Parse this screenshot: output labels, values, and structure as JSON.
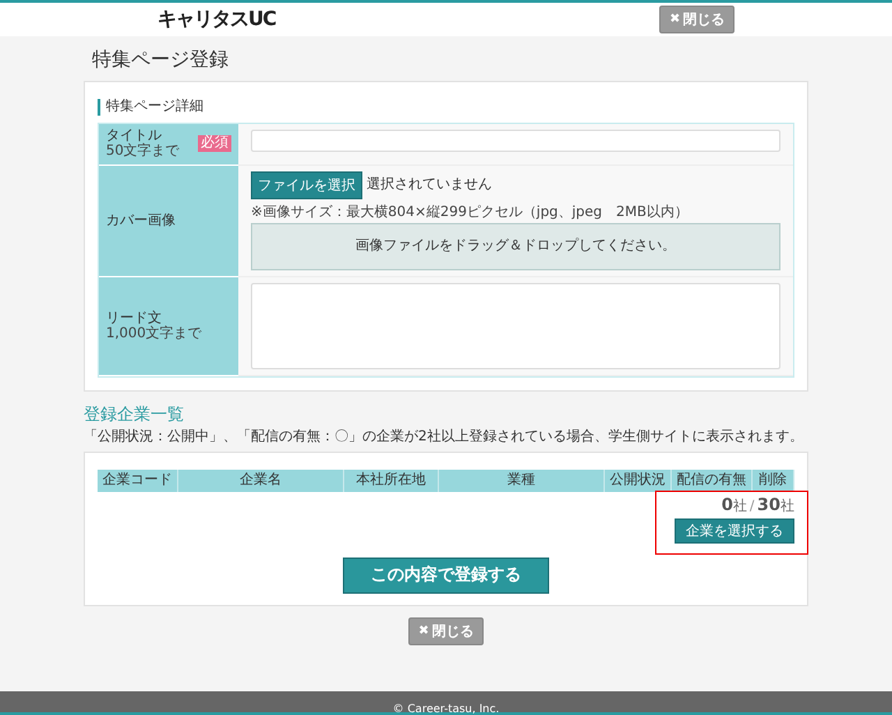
{
  "header": {
    "logo": "キャリタスUC",
    "close_button": {
      "icon": "✖",
      "label": "閉じる"
    }
  },
  "page_title": "特集ページ登録",
  "details": {
    "heading": "特集ページ詳細",
    "fields": [
      {
        "kind": "text",
        "label": "タイトル",
        "hint": "50文字まで",
        "required": true,
        "required_label": "必須"
      },
      {
        "kind": "file",
        "label": "カバー画像",
        "button": "ファイルを選択",
        "status": "選択されていません",
        "note": "※画像サイズ：最大横804×縦299ピクセル（jpg、jpeg　2MB以内）",
        "dropzone": "画像ファイルをドラッグ＆ドロップしてください。"
      },
      {
        "kind": "textarea",
        "label": "リード文",
        "hint": "1,000文字まで"
      }
    ]
  },
  "companies": {
    "heading": "登録企業一覧",
    "note": "「公開状況：公開中」、「配信の有無：〇」の企業が2社以上登録されている場合、学生側サイトに表示されます。",
    "columns": [
      "企業コード",
      "企業名",
      "本社所在地",
      "業種",
      "公開状況",
      "配信の有無",
      "削除"
    ],
    "count": {
      "value": "0",
      "value_unit": "社",
      "separator": "/",
      "limit": "30",
      "limit_unit": "社"
    },
    "select_button": {
      "label": "企業を選択する",
      "highlighted": true
    }
  },
  "submit_button": "この内容で登録する",
  "close_button": {
    "icon": "✖",
    "label": "閉じる"
  },
  "footer": "© Career-tasu, Inc."
}
